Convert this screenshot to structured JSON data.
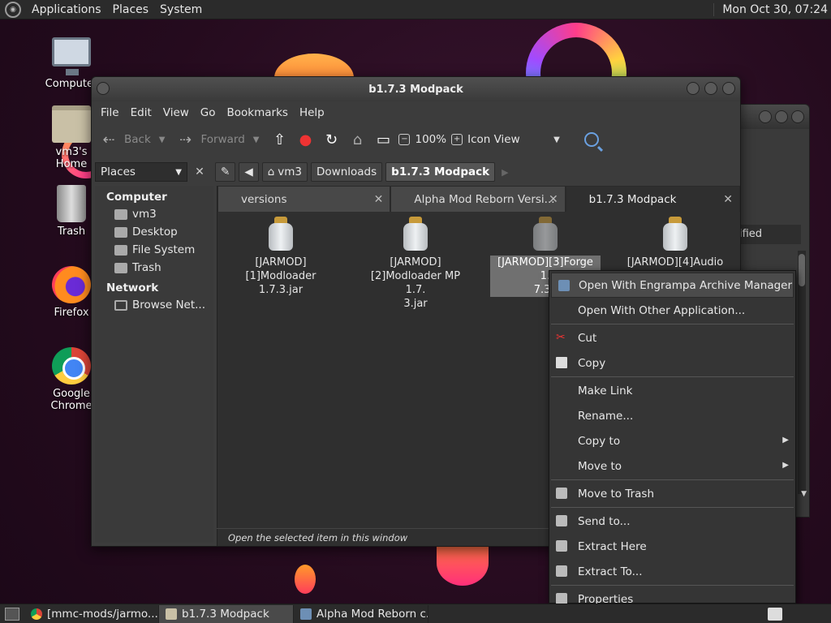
{
  "top_panel": {
    "menus": [
      "Applications",
      "Places",
      "System"
    ],
    "clock": "Mon Oct 30, 07:24"
  },
  "desktop_icons": [
    {
      "label": "Computer",
      "icon": "computer-icon"
    },
    {
      "label": "vm3's Home",
      "icon": "home-folder-icon"
    },
    {
      "label": "Trash",
      "icon": "trash-icon"
    },
    {
      "label": "Firefox",
      "icon": "firefox-icon"
    },
    {
      "label": "Google Chrome",
      "icon": "chrome-icon"
    }
  ],
  "window": {
    "title": "b1.7.3 Modpack",
    "menu": [
      "File",
      "Edit",
      "View",
      "Go",
      "Bookmarks",
      "Help"
    ],
    "toolbar": {
      "back": "Back",
      "forward": "Forward",
      "zoom": "100%",
      "view_mode": "Icon View"
    },
    "sidebar_combo": "Places",
    "breadcrumbs": [
      "vm3",
      "Downloads",
      "b1.7.3 Modpack"
    ],
    "sidebar": {
      "computer_header": "Computer",
      "computer_items": [
        "vm3",
        "Desktop",
        "File System",
        "Trash"
      ],
      "network_header": "Network",
      "network_items": [
        "Browse Net..."
      ]
    },
    "tabs": [
      {
        "label": "versions"
      },
      {
        "label": "Alpha Mod Reborn Versi..."
      },
      {
        "label": "b1.7.3 Modpack"
      }
    ],
    "files": [
      {
        "name": "[JARMOD]\n[1]Modloader 1.7.3.jar"
      },
      {
        "name": "[JARMOD]\n[2]Modloader MP 1.7.\n3.jar"
      },
      {
        "name": "[JARMOD][3]Forge 1.\n7.3.j"
      },
      {
        "name": "[JARMOD][4]Audio"
      }
    ],
    "status": "Open the selected item in this window"
  },
  "background_window": {
    "header_fragment": "ified"
  },
  "context_menu": {
    "items": [
      {
        "label": "Open With Engrampa Archive Manager",
        "icon": "engrampa-icon"
      },
      {
        "label": "Open With Other Application...",
        "icon": ""
      },
      {
        "label": "Cut",
        "icon": "scissors-icon"
      },
      {
        "label": "Copy",
        "icon": "copy-icon"
      },
      {
        "label": "Make Link",
        "icon": ""
      },
      {
        "label": "Rename...",
        "icon": ""
      },
      {
        "label": "Copy to",
        "icon": ""
      },
      {
        "label": "Move to",
        "icon": ""
      },
      {
        "label": "Move to Trash",
        "icon": "trash-icon"
      },
      {
        "label": "Send to...",
        "icon": "send-icon"
      },
      {
        "label": "Extract Here",
        "icon": "extract-icon"
      },
      {
        "label": "Extract To...",
        "icon": "extract-icon"
      },
      {
        "label": "Properties",
        "icon": "properties-icon"
      }
    ]
  },
  "taskbar": [
    {
      "label": "[mmc-mods/jarmo...",
      "icon": "chrome-icon"
    },
    {
      "label": "b1.7.3 Modpack",
      "icon": "folder-icon"
    },
    {
      "label": "Alpha Mod Reborn c...",
      "icon": "engrampa-icon"
    }
  ]
}
